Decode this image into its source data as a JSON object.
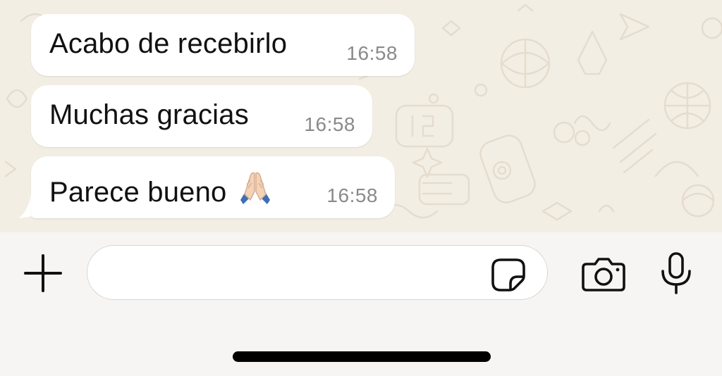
{
  "theme": {
    "chat_background": "#f3eee4",
    "bubble_incoming": "#ffffff",
    "timestamp_color": "#8a8a8a",
    "icon_color": "#111111"
  },
  "messages": [
    {
      "text": "Acabo de recebirlo",
      "time": "16:58",
      "emoji": ""
    },
    {
      "text": "Muchas gracias",
      "time": "16:58",
      "emoji": ""
    },
    {
      "text": "Parece bueno",
      "time": "16:58",
      "emoji": "🙏"
    }
  ],
  "composer": {
    "value": "",
    "placeholder": "",
    "icons": {
      "attach": "plus-icon",
      "sticker": "sticker-icon",
      "camera": "camera-icon",
      "microphone": "microphone-icon"
    }
  }
}
